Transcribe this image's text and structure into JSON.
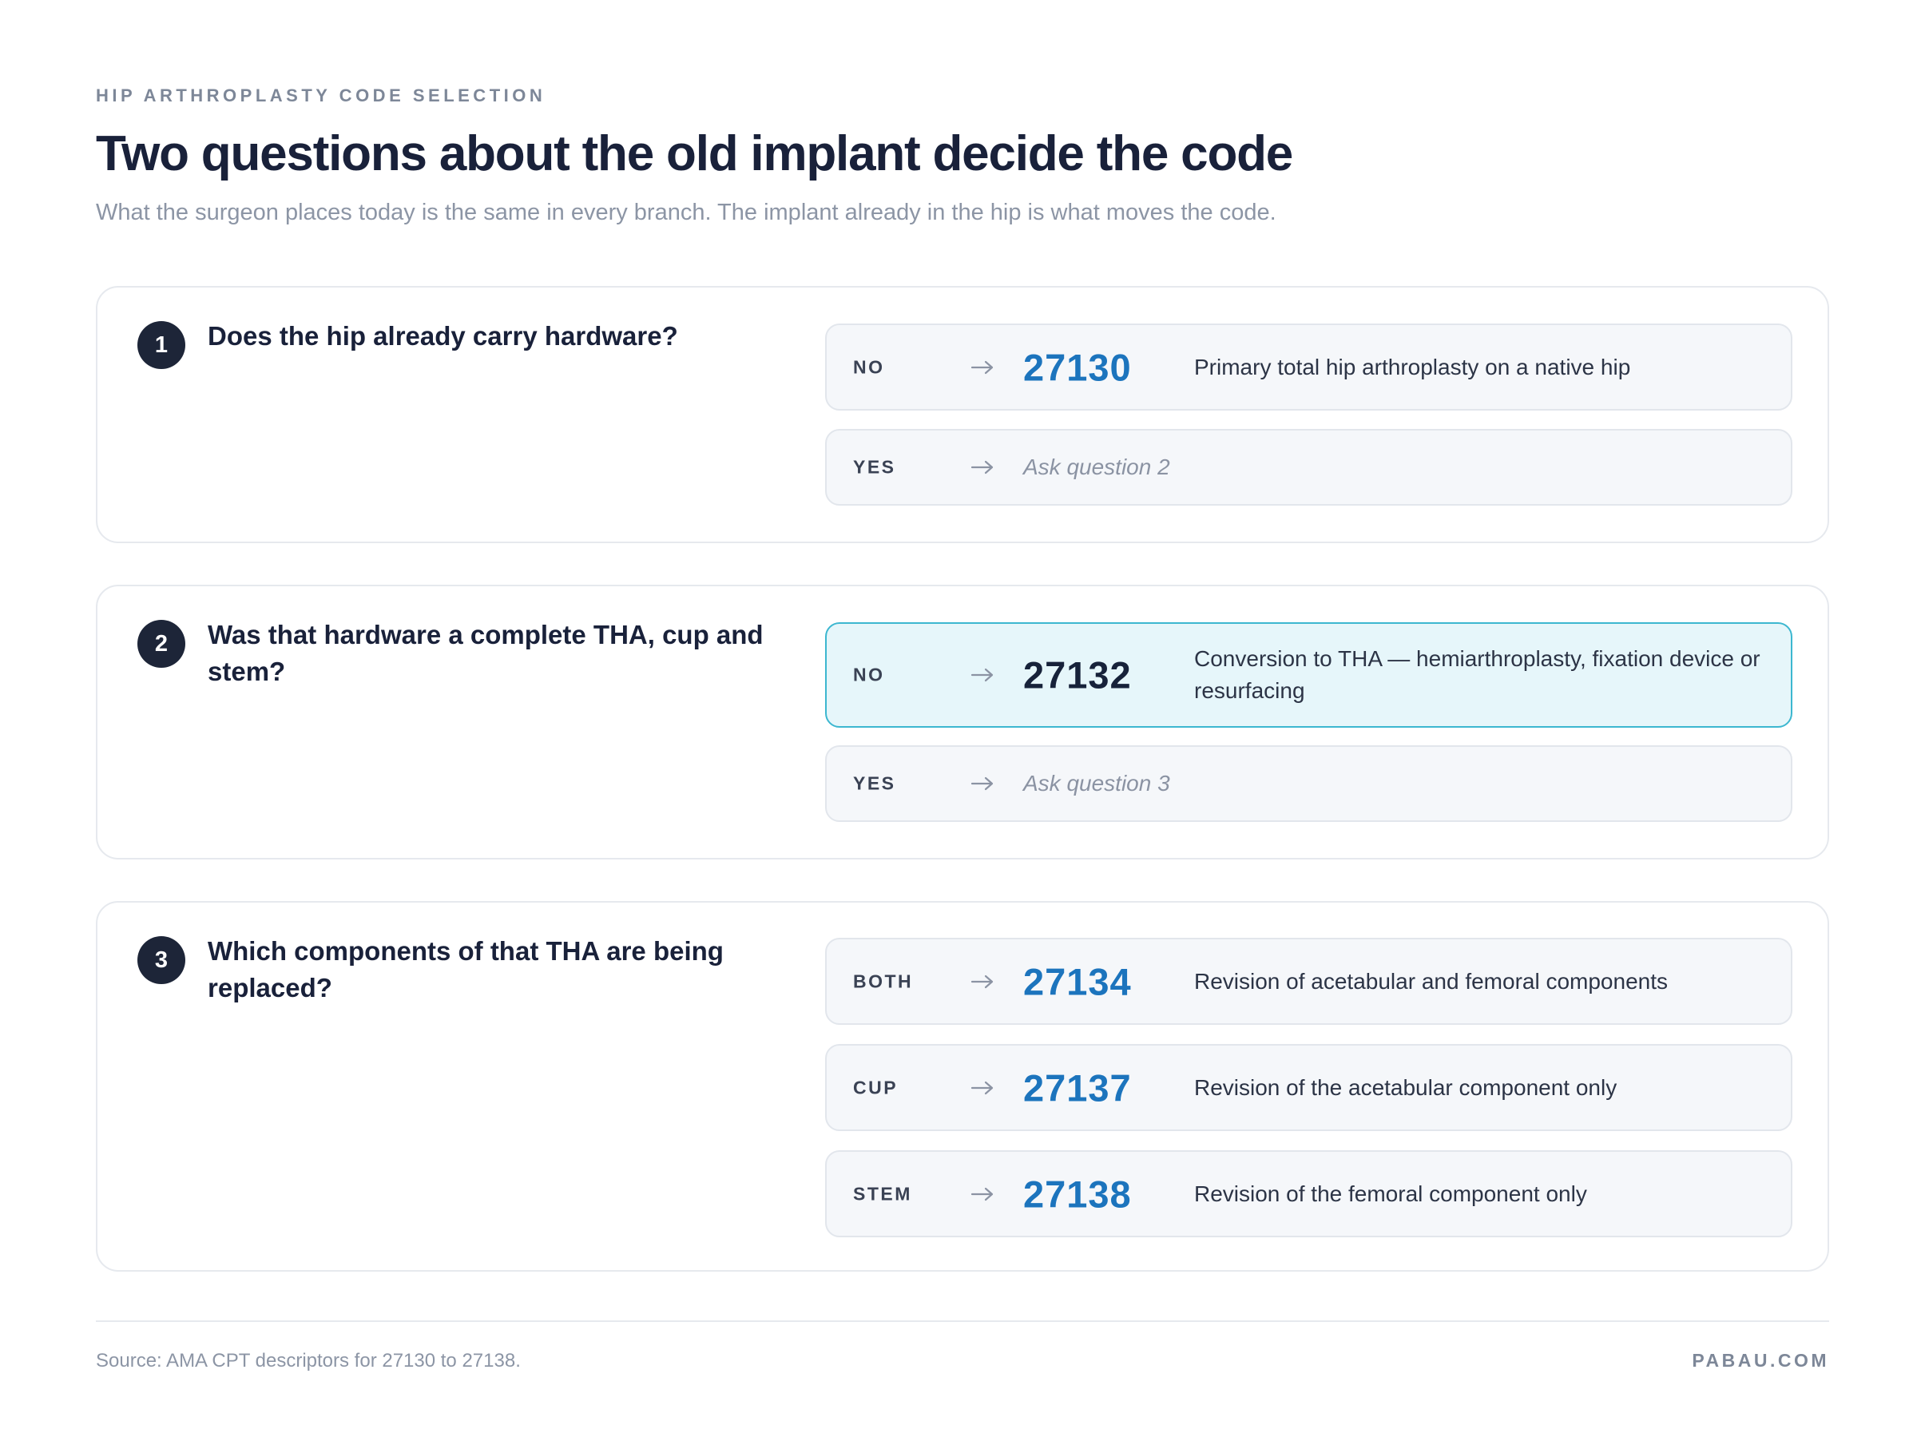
{
  "header": {
    "eyebrow": "HIP ARTHROPLASTY CODE SELECTION",
    "title": "Two questions about the old implant decide the code",
    "subtitle": "What the surgeon places today is the same in every branch. The implant already in the hip is what moves the code."
  },
  "steps": [
    {
      "number": "1",
      "question": "Does the hip already carry hardware?",
      "options": [
        {
          "key": "NO",
          "code": "27130",
          "description": "Primary total hip arthroplasty on a native hip"
        },
        {
          "key": "YES",
          "next": "Ask question 2"
        }
      ]
    },
    {
      "number": "2",
      "question": "Was that hardware a complete THA, cup and stem?",
      "options": [
        {
          "key": "NO",
          "code": "27132",
          "description": "Conversion to THA — hemiarthroplasty, fixation device or resurfacing",
          "highlighted": true
        },
        {
          "key": "YES",
          "next": "Ask question 3"
        }
      ]
    },
    {
      "number": "3",
      "question": "Which components of that THA are being replaced?",
      "options": [
        {
          "key": "BOTH",
          "code": "27134",
          "description": "Revision of acetabular and femoral components"
        },
        {
          "key": "CUP",
          "code": "27137",
          "description": "Revision of the acetabular component only"
        },
        {
          "key": "STEM",
          "code": "27138",
          "description": "Revision of the femoral component only"
        }
      ]
    }
  ],
  "footer": {
    "source": "Source: AMA CPT descriptors for 27130 to 27138.",
    "brand": "PABAU.COM"
  },
  "icons": {
    "arrow": "arrow-right-icon"
  },
  "colors": {
    "code_blue": "#1c74bd",
    "highlight_fill": "#e6f6fa",
    "highlight_border": "#3cb7d0",
    "badge": "#1d2538"
  }
}
